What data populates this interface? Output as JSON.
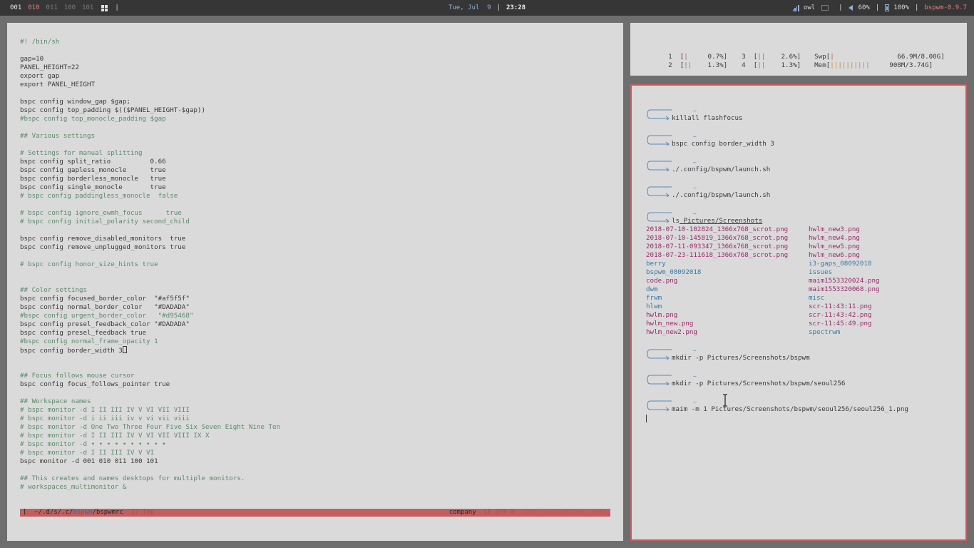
{
  "bar": {
    "workspaces": [
      {
        "label": "001",
        "state": "active"
      },
      {
        "label": "010",
        "state": "urgent"
      },
      {
        "label": "011",
        "state": "inactive"
      },
      {
        "label": "100",
        "state": "inactive"
      },
      {
        "label": "101",
        "state": "inactive"
      }
    ],
    "date": "Tue, Jul  9",
    "time": "23:28",
    "wifi": "owl",
    "volume": "60%",
    "battery": "100%",
    "wm_version": "bspwm-0.9.7",
    "sep": "|",
    "icons": {
      "layout": "grid-icon",
      "wifi": "signal-icon",
      "net": "network-icon",
      "volume": "speaker-icon",
      "battery": "battery-icon"
    }
  },
  "editor": {
    "lines": [
      "#! /bin/sh",
      "",
      "gap=10",
      "PANEL_HEIGHT=22",
      "export gap",
      "export PANEL_HEIGHT",
      "",
      "bspc config window_gap $gap;",
      "bspc config top_padding $(($PANEL_HEIGHT-$gap))",
      "#bspc config top_monocle_padding $gap",
      "",
      "## Various settings",
      "",
      "# Settings for manual splitting",
      "bspc config split_ratio          0.66",
      "bspc config gapless_monocle      true",
      "bspc config borderless_monocle   true",
      "bspc config single_monocle       true",
      "# bspc config paddingless_monocle  false",
      "",
      "# bspc config ignore_ewmh_focus      true",
      "# bspc config initial_polarity second_child",
      "",
      "bspc config remove_disabled_monitors  true",
      "bspc config remove_unplugged_monitors true",
      "",
      "# bspc config honor_size_hints true",
      "",
      "",
      "## Color settings",
      "bspc config focused_border_color  \"#af5f5f\"",
      "bspc config normal_border_color   \"#DADADA\"",
      "#bspc config urgent_border_color   \"#d95468\"",
      "bspc config presel_feedback_color \"#DADADA\"",
      "bspc config presel_feedback true",
      "#bspc config normal_frame_opacity 1",
      "bspc config border_width 3",
      "",
      "",
      "## Focus follows mouse cursor",
      "bspc config focus_follows_pointer true",
      "",
      "## Workspace names",
      "# bspc monitor -d I II III IV V VI VII VIII",
      "# bspc monitor -d i ii iii iv v vi vii viii",
      "# bspc monitor -d One Two Three Four Five Six Seven Eight Nine Ten",
      "# bspc monitor -d I II III IV V VI VII VIII IX X",
      "# bspc monitor -d • • • • • • • • • •",
      "# bspc monitor -d I II III IV V VI",
      "bspc monitor -d 001 010 011 100 101",
      "",
      "## This creates and names desktops for multiple monitors.",
      "# workspaces_multimonitor &"
    ],
    "modeline": {
      "glyph": "[",
      "path_prefix": "~/.d/s/.c/",
      "path_dir": "bspwm",
      "path_sep": "/",
      "filename": "bspwmrc",
      "position": "37 Top",
      "company": "company",
      "encoding": "LF UTF-8",
      "mode": "Shell-script[sh]",
      "line_count": "(sh)"
    }
  },
  "htop": {
    "cpus": [
      {
        "num": "1",
        "bar": "|",
        "value": "0.7%"
      },
      {
        "num": "2",
        "bar": "||",
        "value": "1.3%"
      },
      {
        "num": "3",
        "bar": "||",
        "value": "2.6%"
      },
      {
        "num": "4",
        "bar": "||",
        "value": "1.3%"
      }
    ],
    "swp": {
      "label": "Swp",
      "bar": "|",
      "value": "66.9M/8.00G"
    },
    "mem": {
      "label": "Mem",
      "bar": "||||||||||",
      "value": "908M/3.74G"
    }
  },
  "terminal": {
    "tilde": "~",
    "commands": [
      {
        "cmd": "killall",
        "args": " flashfocus"
      },
      {
        "cmd": "bspc",
        "args": " config border_width 3"
      },
      {
        "cmd": "./.config/bspwm/launch.sh",
        "args": ""
      },
      {
        "cmd": "./.config/bspwm/launch.sh",
        "args": ""
      },
      {
        "cmd": "ls",
        "args": " Pictures/Screenshots"
      }
    ],
    "ls_output": [
      {
        "name": "2018-07-10-102824_1366x768_scrot.png",
        "type": "img"
      },
      {
        "name": "hwlm_new3.png",
        "type": "img"
      },
      {
        "name": "2018-07-10-145819_1366x768_scrot.png",
        "type": "img"
      },
      {
        "name": "hwlm_new4.png",
        "type": "img"
      },
      {
        "name": "2018-07-11-093347_1366x768_scrot.png",
        "type": "img"
      },
      {
        "name": "hwlm_new5.png",
        "type": "img"
      },
      {
        "name": "2018-07-23-111618_1366x768_scrot.png",
        "type": "img"
      },
      {
        "name": "hwlm_new6.png",
        "type": "img"
      },
      {
        "name": "berry",
        "type": "dir"
      },
      {
        "name": "i3-gaps_08092018",
        "type": "dir"
      },
      {
        "name": "bspwm_08092018",
        "type": "dir"
      },
      {
        "name": "issues",
        "type": "dir"
      },
      {
        "name": "code.png",
        "type": "img"
      },
      {
        "name": "maim1553320024.png",
        "type": "img"
      },
      {
        "name": "dwm",
        "type": "dir"
      },
      {
        "name": "maim1553320068.png",
        "type": "img"
      },
      {
        "name": "frwm",
        "type": "dir"
      },
      {
        "name": "misc",
        "type": "dir"
      },
      {
        "name": "hlwm",
        "type": "dir"
      },
      {
        "name": "scr-11:43:11.png",
        "type": "img"
      },
      {
        "name": "hwlm.png",
        "type": "img"
      },
      {
        "name": "scr-11:43:42.png",
        "type": "img"
      },
      {
        "name": "hwlm_new.png",
        "type": "img"
      },
      {
        "name": "scr-11:45:49.png",
        "type": "img"
      },
      {
        "name": "hwlm_new2.png",
        "type": "img"
      },
      {
        "name": "spectrwm",
        "type": "dir"
      }
    ],
    "commands_after": [
      {
        "cmd": "mkdir",
        "args": " -p Pictures/Screenshots/bspwm"
      },
      {
        "cmd": "mkdir",
        "args": " -p Pictures/Screenshots/bspwm/seoul256"
      },
      {
        "cmd": "maim",
        "args": " -m 1 Pictures/Screenshots/bspwm/seoul256/seoul256_1.png"
      }
    ]
  },
  "colors": {
    "focused_border": "#af5f5f",
    "normal_border": "#DADADA",
    "bar_bg": "#363636",
    "accent_blue": "#8fb1d6"
  }
}
